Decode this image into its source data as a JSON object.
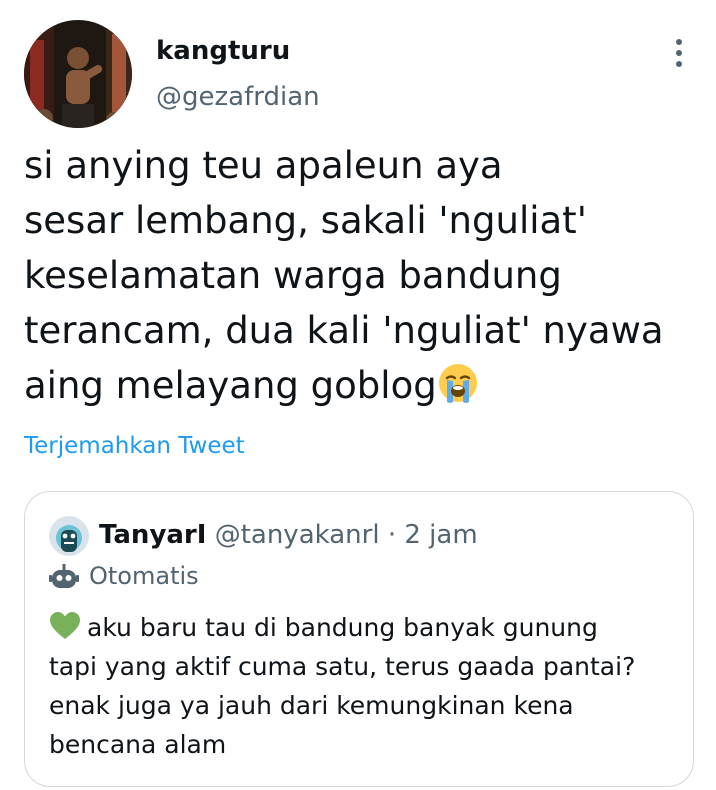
{
  "tweet": {
    "display_name": "kangturu",
    "handle": "@gezafrdian",
    "text_lines": [
      "si anying teu apaleun aya",
      "sesar lembang, sakali 'nguliat'",
      "keselamatan warga bandung",
      "terancam, dua kali 'nguliat' nyawa",
      "aing melayang goblog"
    ],
    "emoji_icon": "loudly-crying-face-icon",
    "translate_label": "Terjemahkan Tweet",
    "more_icon": "more-vertical-icon"
  },
  "quote": {
    "display_name": "TanyarI",
    "handle": "@tanyakanrl",
    "separator": "·",
    "time": "2 jam",
    "automated_label": "Otomatis",
    "automated_icon": "robot-icon",
    "emoji_icon": "green-heart-icon",
    "text_lines": [
      "aku baru tau di bandung banyak gunung",
      "tapi yang aktif cuma satu, terus gaada pantai?",
      "enak juga ya jauh dari kemungkinan kena",
      "bencana alam"
    ]
  },
  "colors": {
    "text_primary": "#0f1419",
    "text_secondary": "#536471",
    "link": "#1d9bf0",
    "border": "#cfd9de"
  }
}
